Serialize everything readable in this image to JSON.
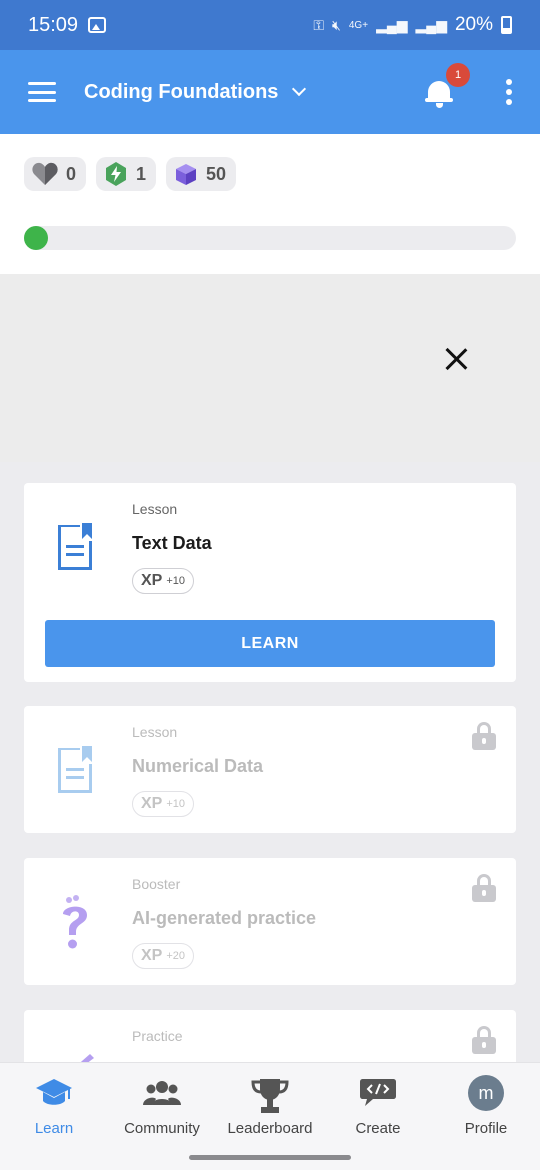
{
  "status_bar": {
    "time": "15:09",
    "network": "4G+",
    "battery": "20%"
  },
  "app_bar": {
    "course_title": "Coding Foundations",
    "notification_count": "1"
  },
  "stats": {
    "hearts": "0",
    "energy": "1",
    "gems": "50"
  },
  "progress": {
    "fraction": 0.0
  },
  "cards": [
    {
      "type": "Lesson",
      "title": "Text Data",
      "xp_label": "XP",
      "xp_bonus": "+10",
      "button_label": "LEARN",
      "locked": false
    },
    {
      "type": "Lesson",
      "title": "Numerical Data",
      "xp_label": "XP",
      "xp_bonus": "+10",
      "locked": true
    },
    {
      "type": "Booster",
      "title": "AI-generated practice",
      "xp_label": "XP",
      "xp_bonus": "+20",
      "locked": true
    },
    {
      "type": "Practice",
      "title": "",
      "locked": true
    }
  ],
  "bottom_nav": [
    {
      "label": "Learn",
      "icon": "graduation-cap-icon",
      "active": true
    },
    {
      "label": "Community",
      "icon": "people-icon",
      "active": false
    },
    {
      "label": "Leaderboard",
      "icon": "trophy-icon",
      "active": false
    },
    {
      "label": "Create",
      "icon": "code-bubble-icon",
      "active": false
    },
    {
      "label": "Profile",
      "icon": "avatar",
      "avatar_letter": "m",
      "active": false
    }
  ],
  "colors": {
    "primary": "#4a95ec",
    "status_bar": "#3f79cf",
    "progress_dot": "#3eb44a",
    "badge": "#d94a3a"
  }
}
